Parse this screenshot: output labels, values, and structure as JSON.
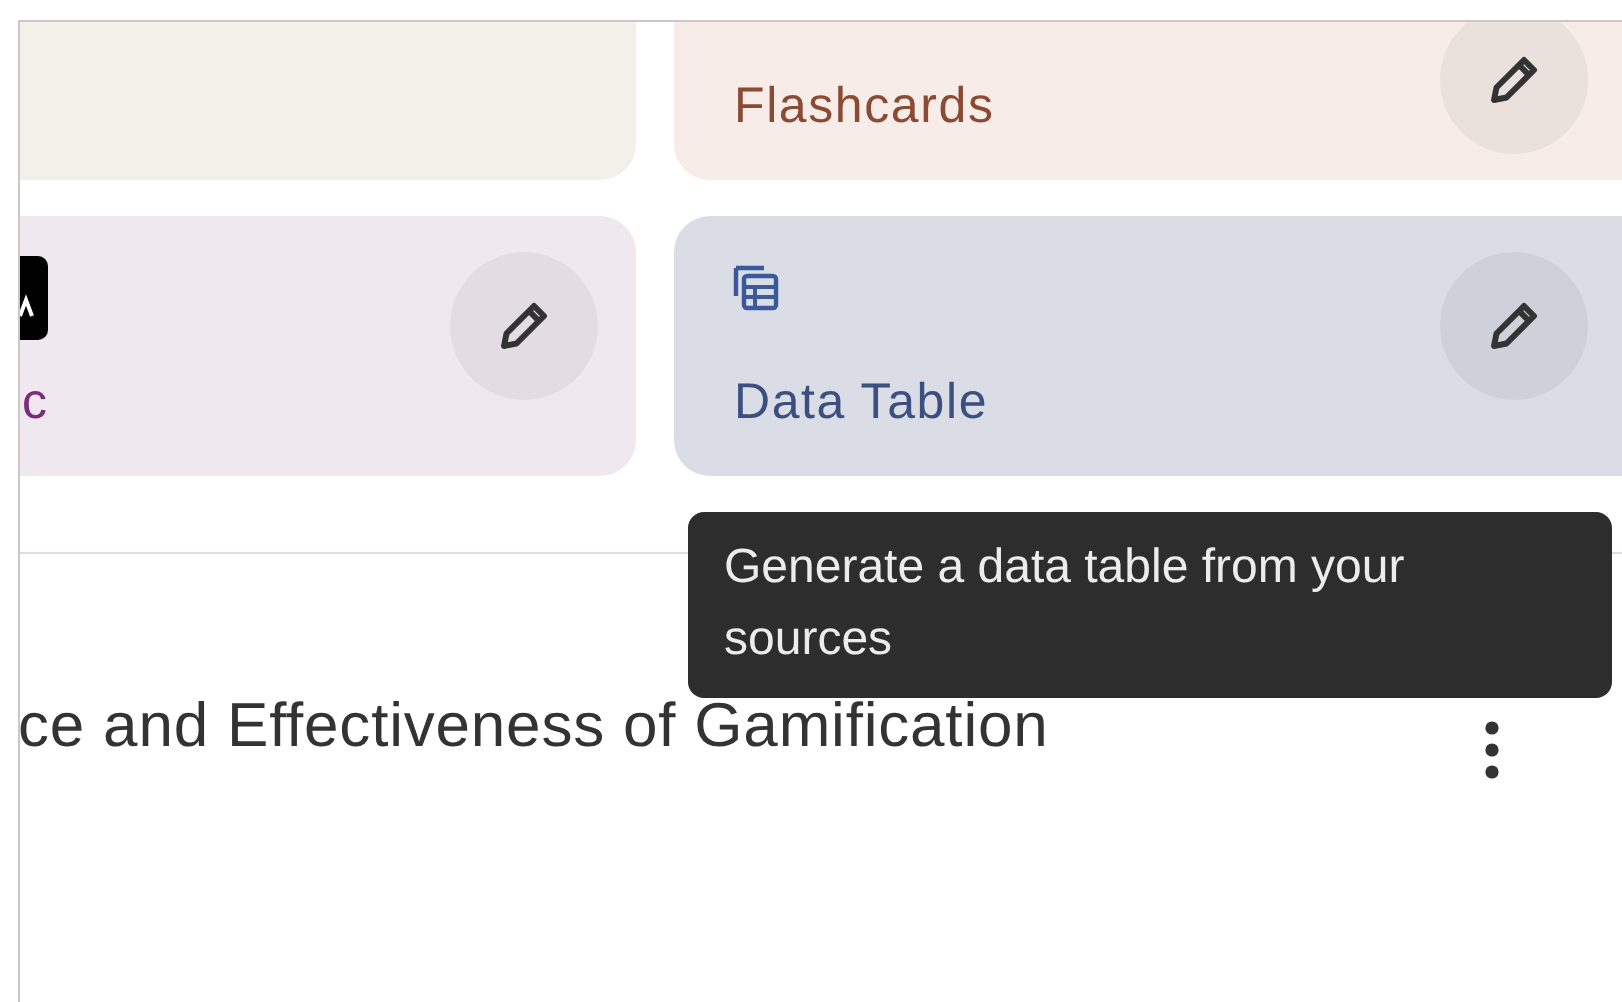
{
  "cards": [
    {
      "kind": "empty",
      "color": "#f1f1e9"
    },
    {
      "kind": "plain",
      "color": "#f7ece8",
      "label": "Flashcards"
    },
    {
      "kind": "logo",
      "color": "#f0e8ef",
      "label": "c"
    },
    {
      "kind": "table",
      "color": "#dadde6",
      "label": "Data Table"
    }
  ],
  "tooltip": {
    "text": "Generate a data table from your sources"
  },
  "note": {
    "title": "ce and Effectiveness of Gamification"
  }
}
